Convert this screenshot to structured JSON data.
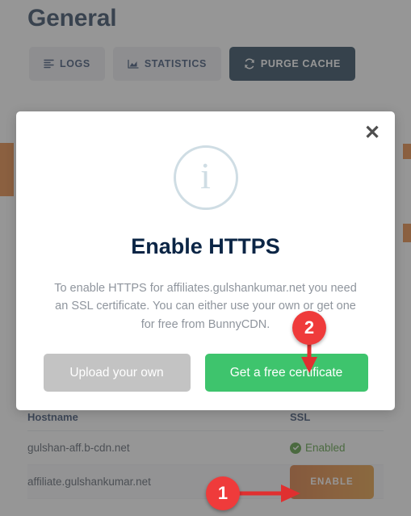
{
  "page": {
    "title": "General",
    "toolbar": [
      {
        "label": "LOGS",
        "icon": "list-icon",
        "style": "light"
      },
      {
        "label": "STATISTICS",
        "icon": "chart-icon",
        "style": "light"
      },
      {
        "label": "PURGE CACHE",
        "icon": "refresh-icon",
        "style": "dark"
      }
    ]
  },
  "table": {
    "columns": [
      "Hostname",
      "SSL"
    ],
    "rows": [
      {
        "hostname": "gulshan-aff.b-cdn.net",
        "ssl_status": "Enabled",
        "ssl_type": "badge"
      },
      {
        "hostname": "affiliate.gulshankumar.net",
        "ssl_action": "ENABLE",
        "ssl_type": "button"
      }
    ]
  },
  "modal": {
    "close_label": "✕",
    "icon": "info-circle-icon",
    "icon_glyph": "i",
    "title": "Enable HTTPS",
    "body": "To enable HTTPS for affiliates.gulshankumar.net you need an SSL certificate. You can either use your own or get one for free from BunnyCDN.",
    "buttons": [
      {
        "label": "Upload your own",
        "variant": "grey"
      },
      {
        "label": "Get a free certificate",
        "variant": "green"
      }
    ]
  },
  "annotations": [
    {
      "id": "1",
      "label": "1",
      "points_to": "enable-button",
      "arrow": "right"
    },
    {
      "id": "2",
      "label": "2",
      "points_to": "get-free-certificate-button",
      "arrow": "down"
    }
  ],
  "colors": {
    "accent_navy": "#0b2545",
    "accent_orange": "#e2711d",
    "success_green": "#3a8c1e",
    "button_green": "#3ec46d",
    "marker_red": "#ef3b3b",
    "info_blue": "#cfdde4",
    "overlay": "rgba(86,86,86,0.62)"
  }
}
